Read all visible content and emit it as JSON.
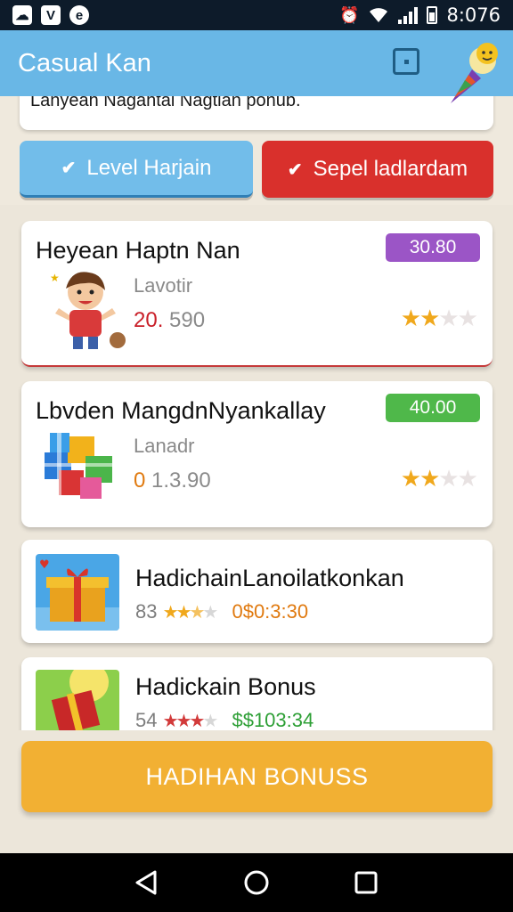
{
  "status_bar": {
    "left_icons": [
      "cloud-app-icon",
      "v-app-icon",
      "e-app-icon"
    ],
    "time": "8:076"
  },
  "app_bar": {
    "title": "Casual Kan"
  },
  "notice": {
    "text": "Lanyeah Nagahtai Nagtian ponub."
  },
  "filters": [
    {
      "label": "Level Harjain",
      "color": "#72bdea"
    },
    {
      "label": "Sepel ladlardam",
      "color": "#d9302c"
    }
  ],
  "items": [
    {
      "title": "Heyean Haptn Nan",
      "subtitle": "Lavotir",
      "price_lead": "20.",
      "price_rest": " 590",
      "badge": "30.80",
      "badge_color": "#9b55c6",
      "rating": 2,
      "rating_max": 4
    },
    {
      "title": "Lbvden MangdnNyankallay",
      "subtitle": "Lanadr",
      "price_lead": "0",
      "price_rest": " 1.3.90",
      "badge": "40.00",
      "badge_color": "#4fb84a",
      "rating": 2,
      "rating_max": 4
    },
    {
      "title": "HadichainLanoilatkonkan",
      "count": "83",
      "amount": "0$0:3:30"
    },
    {
      "title": "Hadickain Bonus",
      "count": "54",
      "amount": "$$103:34"
    }
  ],
  "bonus_button": {
    "label": "HADIHAN BONUSS"
  },
  "nav": {
    "icons": [
      "back-icon",
      "home-icon",
      "recents-icon"
    ]
  }
}
